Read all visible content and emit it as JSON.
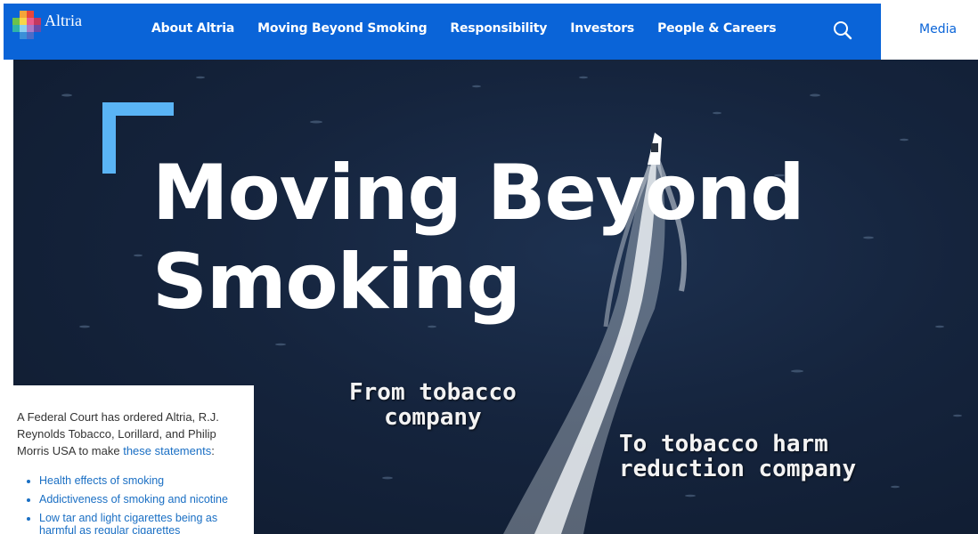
{
  "header": {
    "logo_text": "Altria",
    "nav": [
      {
        "label": "About Altria"
      },
      {
        "label": "Moving Beyond Smoking"
      },
      {
        "label": "Responsibility"
      },
      {
        "label": "Investors"
      },
      {
        "label": "People & Careers"
      }
    ],
    "search_icon": "search-icon",
    "media_label": "Media"
  },
  "hero": {
    "headline_line1": "Moving Beyond",
    "headline_line2": "Smoking",
    "caption_from_line1": "From tobacco",
    "caption_from_line2": "company",
    "caption_to_line1": "To tobacco harm",
    "caption_to_line2": "reduction company"
  },
  "notice": {
    "text_before_link": "A Federal Court has ordered Altria, R.J. Reynolds Tobacco, Lorillard, and Philip Morris USA to make ",
    "link_text": "these statements",
    "text_after_link": ":",
    "items": [
      {
        "label": "Health effects of smoking"
      },
      {
        "label": "Addictiveness of smoking and nicotine"
      },
      {
        "label": "Low tar and light cigarettes being as harmful as regular cigarettes"
      }
    ]
  },
  "colors": {
    "header_blue": "#0a64d8",
    "link_blue": "#1a6fc4",
    "bracket_light_blue": "#5ab4f5",
    "ocean_dark": "#15243d"
  }
}
